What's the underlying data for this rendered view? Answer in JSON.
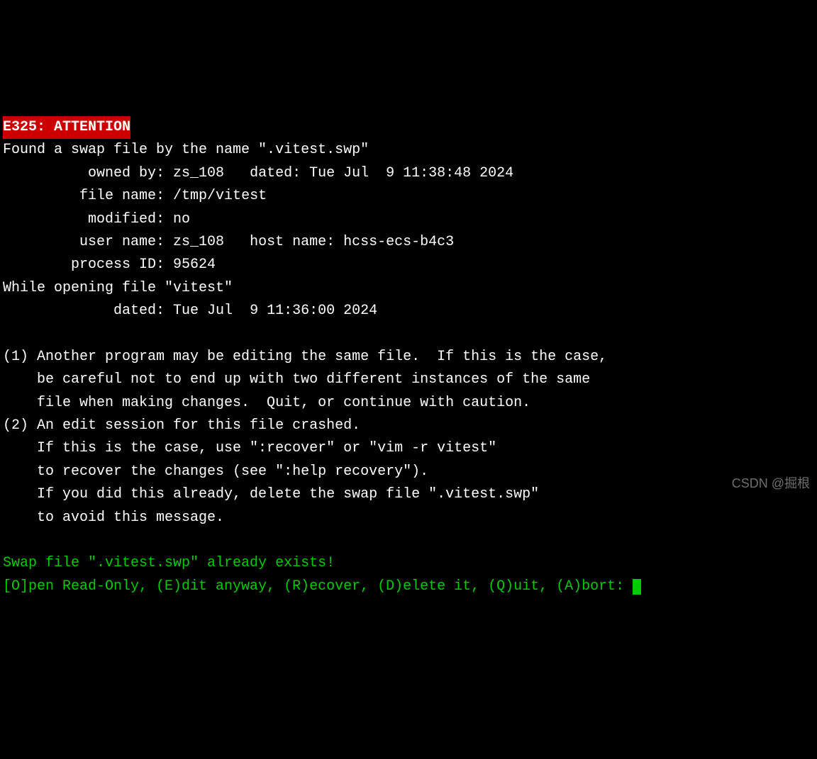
{
  "header": "E325: ATTENTION",
  "swap": {
    "found_line": "Found a swap file by the name \".vitest.swp\"",
    "owned_by_label": "          owned by: ",
    "owned_by": "zs_108",
    "dated_label": "   dated: ",
    "dated": "Tue Jul  9 11:38:48 2024",
    "file_name_label": "         file name: ",
    "file_name": "/tmp/vitest",
    "modified_label": "          modified: ",
    "modified": "no",
    "user_name_label": "         user name: ",
    "user_name": "zs_108",
    "host_label": "   host name: ",
    "host_name": "hcss-ecs-b4c3",
    "pid_label": "        process ID: ",
    "pid": "95624"
  },
  "opening": {
    "line": "While opening file \"vitest\"",
    "dated_label": "             dated: ",
    "dated": "Tue Jul  9 11:36:00 2024"
  },
  "msg": {
    "l1": "(1) Another program may be editing the same file.  If this is the case,",
    "l2": "    be careful not to end up with two different instances of the same",
    "l3": "    file when making changes.  Quit, or continue with caution.",
    "l4": "(2) An edit session for this file crashed.",
    "l5": "    If this is the case, use \":recover\" or \"vim -r vitest\"",
    "l6": "    to recover the changes (see \":help recovery\").",
    "l7": "    If you did this already, delete the swap file \".vitest.swp\"",
    "l8": "    to avoid this message."
  },
  "prompt": {
    "exists": "Swap file \".vitest.swp\" already exists!",
    "options": "[O]pen Read-Only, (E)dit anyway, (R)ecover, (D)elete it, (Q)uit, (A)bort: "
  },
  "watermark": "CSDN @掘根"
}
